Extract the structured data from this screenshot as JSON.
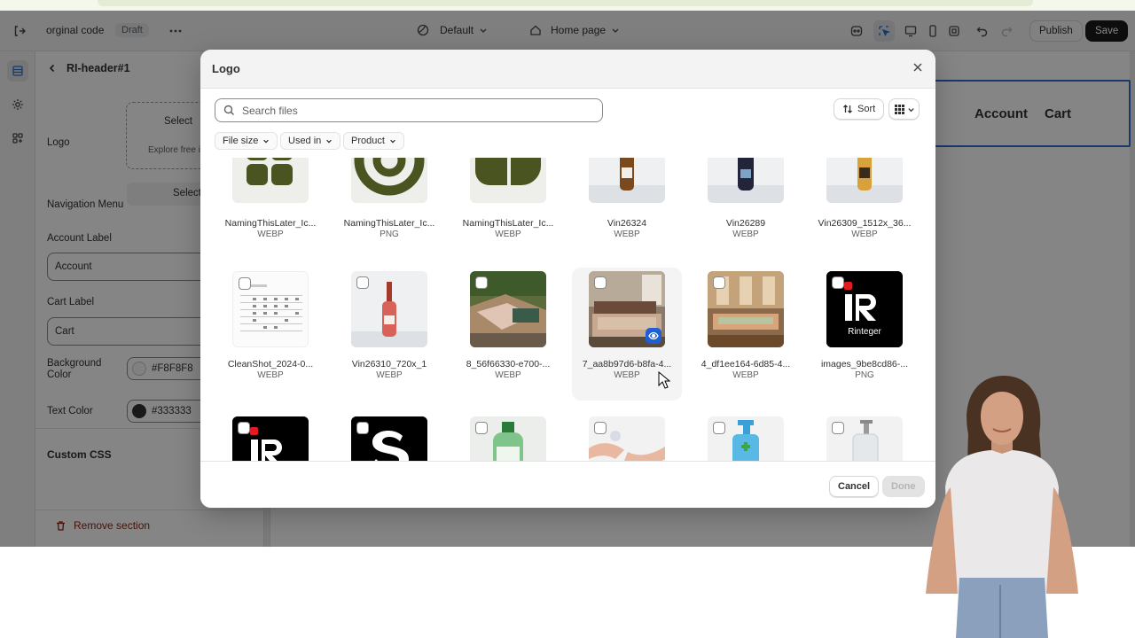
{
  "topbar": {
    "theme_name": "orginal code",
    "status_badge": "Draft",
    "template": "Default",
    "page": "Home page",
    "publish_label": "Publish",
    "save_label": "Save"
  },
  "sidebar": {
    "section_title": "RI-header#1",
    "logo_label": "Logo",
    "logo_select": "Select",
    "logo_explore": "Explore free i",
    "nav_label": "Navigation Menu",
    "nav_select": "Select",
    "account_label_title": "Account Label",
    "account_label_value": "Account",
    "cart_label_title": "Cart Label",
    "cart_label_value": "Cart",
    "bg_color_label": "Background Color",
    "bg_color_value": "#F8F8F8",
    "text_color_label": "Text Color",
    "text_color_value": "#333333",
    "custom_css": "Custom CSS",
    "remove_section": "Remove section"
  },
  "preview": {
    "account": "Account",
    "cart": "Cart"
  },
  "modal": {
    "title": "Logo",
    "search_placeholder": "Search files",
    "sort_label": "Sort",
    "filters": [
      "File size",
      "Used in",
      "Product"
    ],
    "cancel_label": "Cancel",
    "done_label": "Done",
    "files": [
      {
        "name": "NamingThisLater_Ic...",
        "type": "WEBP",
        "thumb": "green-squares"
      },
      {
        "name": "NamingThisLater_Ic...",
        "type": "PNG",
        "thumb": "green-rings"
      },
      {
        "name": "NamingThisLater_Ic...",
        "type": "WEBP",
        "thumb": "green-shapes"
      },
      {
        "name": "Vin26324",
        "type": "WEBP",
        "thumb": "bottle-amber"
      },
      {
        "name": "Vin26289",
        "type": "WEBP",
        "thumb": "bottle-dark"
      },
      {
        "name": "Vin26309_1512x_36...",
        "type": "WEBP",
        "thumb": "bottle-gold"
      },
      {
        "name": "CleanShot_2024-0...",
        "type": "WEBP",
        "thumb": "calendar"
      },
      {
        "name": "Vin26310_720x_1",
        "type": "WEBP",
        "thumb": "bottle-rose"
      },
      {
        "name": "8_56f66330-e700-...",
        "type": "WEBP",
        "thumb": "terrace"
      },
      {
        "name": "7_aa8b97d6-b8fa-4...",
        "type": "WEBP",
        "thumb": "bedroom"
      },
      {
        "name": "4_df1ee164-6d85-4...",
        "type": "WEBP",
        "thumb": "livingroom"
      },
      {
        "name": "images_9be8cd86-...",
        "type": "PNG",
        "thumb": "ri-logo"
      },
      {
        "name": "",
        "type": "",
        "thumb": "ri-logo"
      },
      {
        "name": "",
        "type": "",
        "thumb": "s-logo"
      },
      {
        "name": "",
        "type": "",
        "thumb": "green-bottle"
      },
      {
        "name": "",
        "type": "",
        "thumb": "hands"
      },
      {
        "name": "",
        "type": "",
        "thumb": "pump-bottle"
      },
      {
        "name": "",
        "type": "",
        "thumb": "clear-pump"
      }
    ],
    "ri_logo_text": "Rinteger"
  },
  "colors": {
    "accent_blue": "#2c6ecb",
    "save_button": "#1a1a1a",
    "remove_red": "#8e1f0b",
    "logo_green": "#4a5421"
  }
}
